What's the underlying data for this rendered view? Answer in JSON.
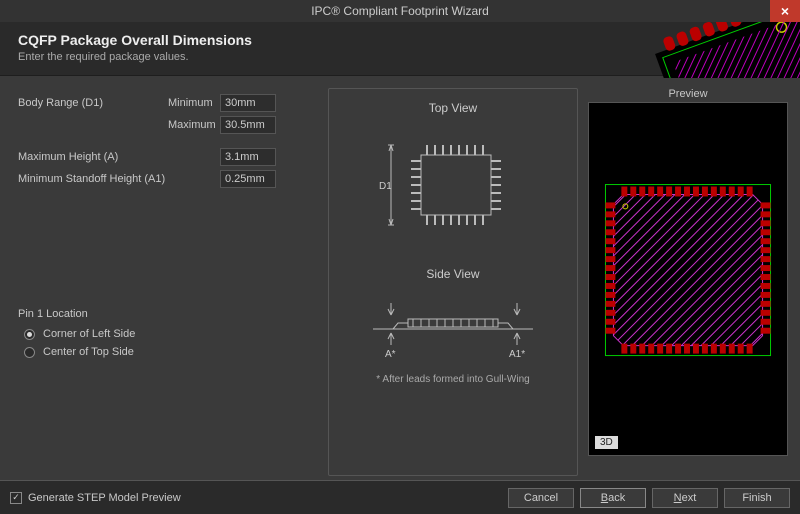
{
  "titlebar": {
    "title": "IPC® Compliant Footprint Wizard"
  },
  "header": {
    "title": "CQFP Package Overall Dimensions",
    "subtitle": "Enter the required package values."
  },
  "form": {
    "body_range_label": "Body Range (D1)",
    "min_label": "Minimum",
    "max_label": "Maximum",
    "body_min": "30mm",
    "body_max": "30.5mm",
    "max_height_label": "Maximum Height (A)",
    "max_height": "3.1mm",
    "min_standoff_label": "Minimum Standoff Height (A1)",
    "min_standoff": "0.25mm"
  },
  "pin1": {
    "section_label": "Pin 1 Location",
    "opt_corner": "Corner of Left Side",
    "opt_center": "Center of Top Side"
  },
  "diagram": {
    "top_view": "Top View",
    "side_view": "Side View",
    "d1": "D1",
    "a": "A*",
    "a1": "A1*",
    "footnote": "* After leads formed into Gull-Wing"
  },
  "preview": {
    "label": "Preview",
    "badge": "3D"
  },
  "footer": {
    "step_label": "Generate STEP Model Preview",
    "cancel": "Cancel",
    "back": "Back",
    "next": "Next",
    "finish": "Finish"
  }
}
